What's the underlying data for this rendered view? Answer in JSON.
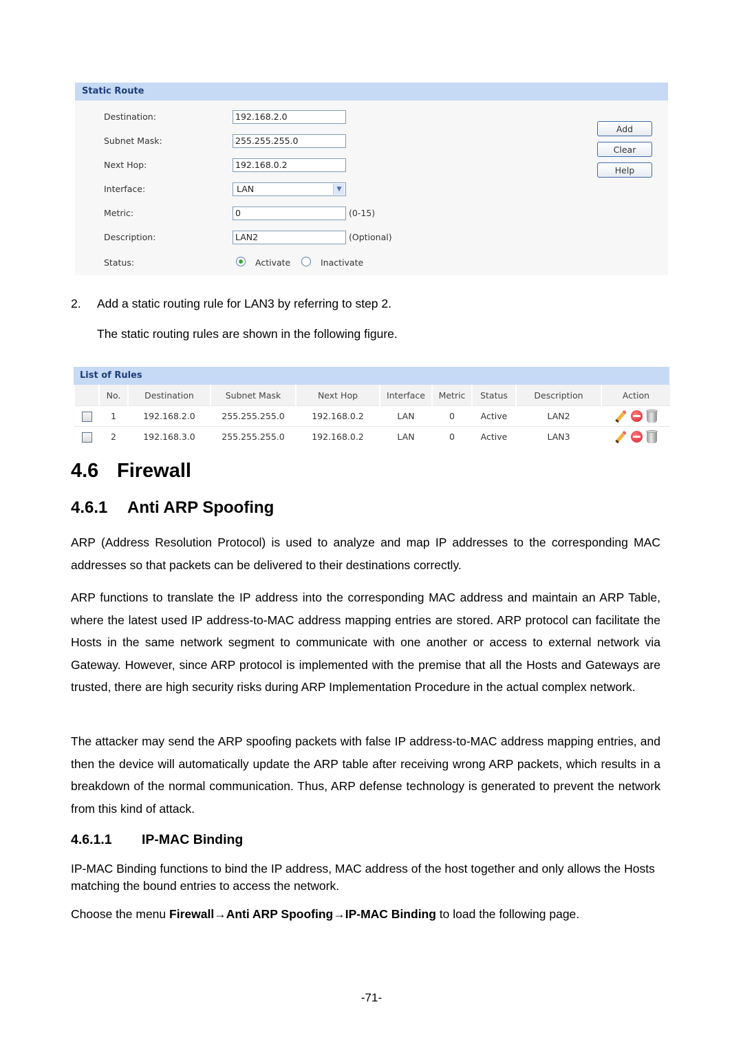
{
  "static_route": {
    "title": "Static Route",
    "fields": [
      {
        "label": "Destination:",
        "value": "192.168.2.0"
      },
      {
        "label": "Subnet Mask:",
        "value": "255.255.255.0"
      },
      {
        "label": "Next Hop:",
        "value": "192.168.0.2"
      },
      {
        "label": "Interface:",
        "value": "LAN"
      },
      {
        "label": "Metric:",
        "value": "0",
        "hint": "(0-15)"
      },
      {
        "label": "Description:",
        "value": "LAN2",
        "hint": "(Optional)"
      }
    ],
    "status": {
      "label": "Status:",
      "options": [
        "Activate",
        "Inactivate"
      ],
      "selected": "Activate"
    },
    "buttons": {
      "add": "Add",
      "clear": "Clear",
      "help": "Help"
    }
  },
  "step2": {
    "number": "2.",
    "text": "Add a static routing rule for LAN3 by referring to step 2.",
    "caption": "The static routing rules are shown in the following figure."
  },
  "rules_list": {
    "title": "List of Rules",
    "columns": [
      "",
      "No.",
      "Destination",
      "Subnet Mask",
      "Next Hop",
      "Interface",
      "Metric",
      "Status",
      "Description",
      "Action"
    ],
    "rows": [
      {
        "no": "1",
        "destination": "192.168.2.0",
        "subnet_mask": "255.255.255.0",
        "next_hop": "192.168.0.2",
        "interface": "LAN",
        "metric": "0",
        "status": "Active",
        "description": "LAN2",
        "actions": [
          "edit-icon",
          "disable-icon",
          "delete-icon"
        ]
      },
      {
        "no": "2",
        "destination": "192.168.3.0",
        "subnet_mask": "255.255.255.0",
        "next_hop": "192.168.0.2",
        "interface": "LAN",
        "metric": "0",
        "status": "Active",
        "description": "LAN3",
        "actions": [
          "edit-icon",
          "disable-icon",
          "delete-icon"
        ]
      }
    ]
  },
  "section": {
    "number": "4.6",
    "title": "Firewall"
  },
  "subsection": {
    "number": "4.6.1",
    "title": "Anti ARP Spoofing"
  },
  "paragraphs": [
    "ARP (Address Resolution Protocol) is used to analyze and map IP addresses to the corresponding MAC addresses so that packets can be delivered to their destinations correctly.",
    "ARP functions to translate the IP address into the corresponding MAC address and maintain an ARP Table, where the latest used IP address-to-MAC address mapping entries are stored. ARP protocol can facilitate the Hosts in the same network segment to communicate with one another or access to external network via Gateway. However, since ARP protocol is implemented with the premise that all the Hosts and Gateways are trusted, there are high security risks during ARP Implementation Procedure in the actual complex network.",
    "The attacker may send the ARP spoofing packets with false IP address-to-MAC address mapping entries, and then the device will automatically update the ARP table after receiving wrong ARP packets, which results in a breakdown of the normal communication. Thus, ARP defense technology is generated to prevent the network from this kind of attack."
  ],
  "subsubsection": {
    "number": "4.6.1.1",
    "title": "IP-MAC Binding"
  },
  "ipmac_paragraph": "IP-MAC Binding functions to bind the IP address, MAC address of the host together and only allows the Hosts matching the bound entries to access the network.",
  "menu_instruction": {
    "prefix": "Choose the menu ",
    "path_1": "Firewall",
    "arrow": "→",
    "path_2": "Anti ARP Spoofing",
    "path_3": "IP-MAC Binding",
    "suffix": " to load the following page."
  },
  "page_number": "-71-"
}
